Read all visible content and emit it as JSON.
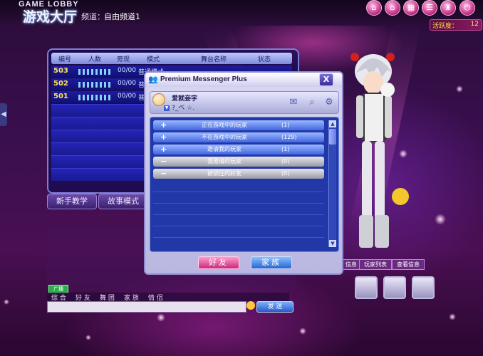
{
  "topbar": {
    "logo_small": "GAME LOBBY",
    "logo_big": "游戏大厅",
    "channel_label": "频道：",
    "channel_value": "自由频道1",
    "icons": [
      "home-icon",
      "house-icon",
      "shop-icon",
      "menu-icon",
      "wardrobe-icon",
      "exit-icon"
    ],
    "activity_label": "活跃度：",
    "activity_value": "12"
  },
  "room_table": {
    "headers": [
      "编号",
      "人数",
      "旁观",
      "模式",
      "舞台名称",
      "状态"
    ],
    "rows": [
      {
        "id": "503",
        "spectators": "00/00",
        "mode": "普通模式"
      },
      {
        "id": "502",
        "spectators": "00/00",
        "mode": "普通"
      },
      {
        "id": "501",
        "spectators": "00/00",
        "mode": "普通"
      }
    ],
    "stage_name_partial": "我们来跳舞吧!",
    "status_partial": "CHATTING"
  },
  "mode_buttons": [
    "新手教学",
    "故事模式"
  ],
  "chat": {
    "broadcast_label": "广播",
    "tabs": [
      "综 合",
      "好 友",
      "舞 团",
      "家 族",
      "情 侣"
    ],
    "send_label": "发 送"
  },
  "messenger": {
    "title": "Premium Messenger Plus",
    "close_label": "X",
    "profile": {
      "username": "爱就妾字",
      "status_text": "?_ベ  ☆.",
      "icons": [
        "mail-icon",
        "search-icon",
        "settings-icon"
      ]
    },
    "groups": [
      {
        "sign": "+",
        "name": "正在游戏中的玩家",
        "count": "(1)",
        "style": "blue"
      },
      {
        "sign": "+",
        "name": "不在游戏中的玩家",
        "count": "(129)",
        "style": "blue"
      },
      {
        "sign": "+",
        "name": "邀请我的玩家",
        "count": "(1)",
        "style": "blue"
      },
      {
        "sign": "−",
        "name": "我邀请的玩家",
        "count": "(0)",
        "style": "gray"
      },
      {
        "sign": "−",
        "name": "被锁住的好友",
        "count": "(0)",
        "style": "gray"
      }
    ],
    "buttons": {
      "friends": "好友",
      "family": "家族"
    }
  },
  "side": {
    "buttons": [
      "信息",
      "玩家列表",
      "查看信息"
    ]
  }
}
